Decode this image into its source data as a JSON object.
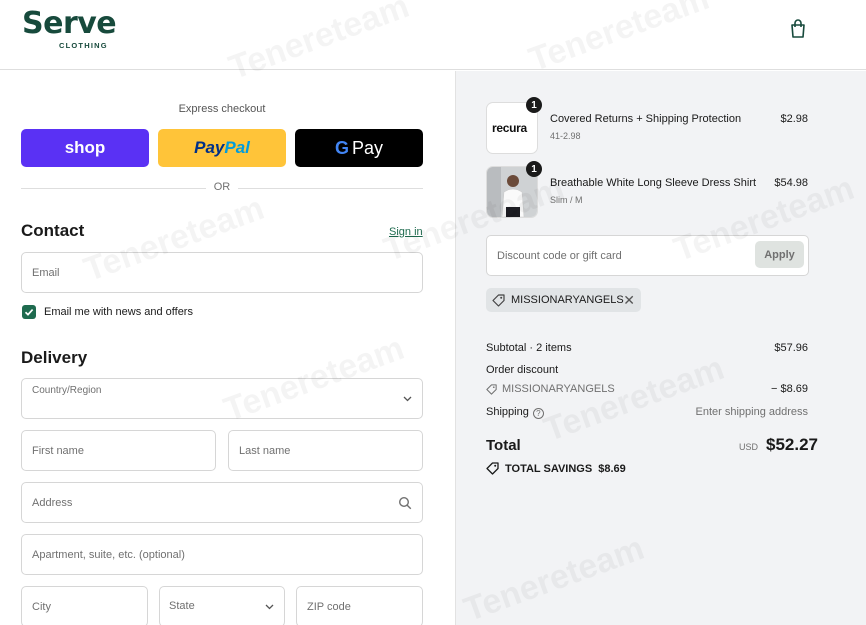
{
  "brand": {
    "logo_text": "Serve",
    "logo_sub": "CLOTHING"
  },
  "watermark": "Tenereteam",
  "express": {
    "title": "Express checkout",
    "shop_label": "shop",
    "paypal_a": "Pay",
    "paypal_b": "Pal",
    "gpay_g": "G",
    "gpay_label": "Pay",
    "or_label": "OR"
  },
  "contact": {
    "heading": "Contact",
    "sign_in": "Sign in",
    "email_placeholder": "Email",
    "newsletter_label": "Email me with news and offers",
    "newsletter_checked": true
  },
  "delivery": {
    "heading": "Delivery",
    "country_label": "Country/Region",
    "first_name": "First name",
    "last_name": "Last name",
    "address": "Address",
    "apartment": "Apartment, suite, etc. (optional)",
    "city": "City",
    "state": "State",
    "zip": "ZIP code"
  },
  "cart": {
    "items": [
      {
        "name": "Covered Returns + Shipping Protection",
        "variant": "41-2.98",
        "price": "$2.98",
        "quantity": "1",
        "thumb_text": "recura"
      },
      {
        "name": "Breathable White Long Sleeve Dress Shirt",
        "variant": "Slim / M",
        "price": "$54.98",
        "quantity": "1"
      }
    ],
    "discount_placeholder": "Discount code or gift card",
    "apply_label": "Apply",
    "applied_code": "MISSIONARYANGELS"
  },
  "summary": {
    "subtotal_label": "Subtotal · 2 items",
    "subtotal_value": "$57.96",
    "order_discount_label": "Order discount",
    "discount_code": "MISSIONARYANGELS",
    "discount_value": "− $8.69",
    "shipping_label": "Shipping",
    "shipping_value": "Enter shipping address",
    "total_label": "Total",
    "currency": "USD",
    "total_value": "$52.27",
    "savings_label": "TOTAL SAVINGS",
    "savings_value": "$8.69"
  },
  "colors": {
    "accent": "#1f6b4f",
    "shop": "#5a31f4",
    "paypal": "#ffc439",
    "gpay": "#000000",
    "summary_bg": "#f2f3f5"
  }
}
